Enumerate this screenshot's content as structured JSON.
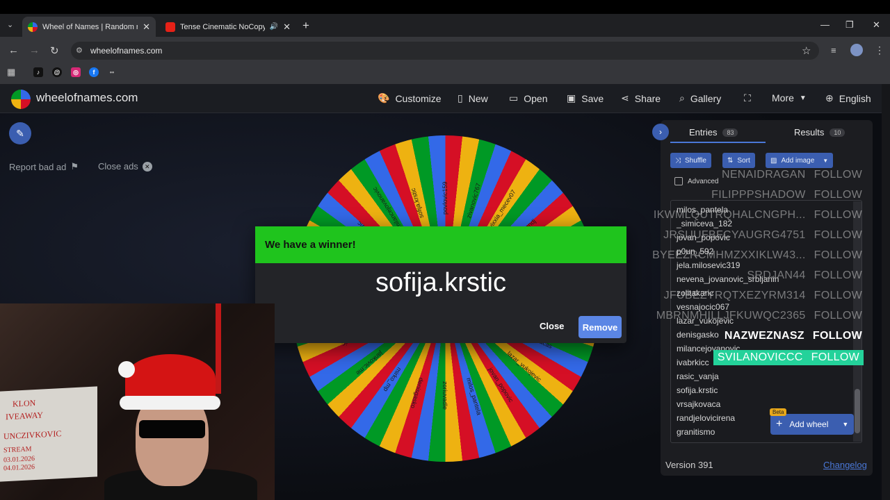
{
  "browser": {
    "tabs": [
      {
        "title": "Wheel of Names | Random nam",
        "active": true
      },
      {
        "title": "Tense Cinematic NoCopyrig",
        "active": false
      }
    ],
    "url": "wheelofnames.com"
  },
  "site": {
    "logo": "wheelofnames.com",
    "menu": [
      "Customize",
      "New",
      "Open",
      "Save",
      "Share",
      "Gallery",
      "More",
      "English"
    ],
    "report_bad_ad": "Report bad ad",
    "close_ads": "Close ads"
  },
  "wheel_labels": [
    "povlovic159",
    "zivanovic767",
    "vixxia_mecev07",
    "andjela_andj",
    "mendlo.bogatinov",
    "markosmdkovic9",
    "mana_dragan",
    "vsajkovacas",
    "lazar_vukojevic",
    "jovan_popovic",
    "milos_pantela",
    "zoriuvadle",
    "denisgasko",
    "mirko_mp",
    "jankovic.me",
    "stevanovic",
    "dijana_pajic",
    "xayrl_frisan",
    "minia_zviczcr",
    "sasiwojovic",
    "milancejovanovic",
    "sofija.krstic"
  ],
  "dialog": {
    "title": "We have a winner!",
    "winner": "sofija.krstic",
    "close_label": "Close",
    "remove_label": "Remove"
  },
  "panel": {
    "entries_tab": "Entries",
    "entries_count": "83",
    "results_tab": "Results",
    "results_count": "10",
    "shuffle": "Shuffle",
    "sort": "Sort",
    "add_image": "Add image",
    "advanced": "Advanced",
    "entries": [
      "milos_pantela",
      "_simiceva_182",
      "jovan_popovic",
      "p0un_592",
      "jela.milosevic319",
      "nevena_jovanovic_srbljanin",
      "zolitakaric",
      "vesnajocic067",
      "lazar_vukojevic",
      "denisgasko",
      "milancejovanovic",
      "ivabrkicc",
      "rasic_vanja",
      "sofija.krstic",
      "vrsajkovaca",
      "randjelovicirena",
      "granitismo"
    ],
    "add_wheel": "Add wheel",
    "beta": "Beta",
    "version": "Version 391",
    "changelog": "Changelog"
  },
  "overlay": {
    "follow_label": "FOLLOW",
    "names": [
      "NENAIDRAGAN",
      "FILIPPPSHADOW",
      "IKWMLQUTRQHALCNGPH...",
      "JRSUUFBFCYAUGRG4751",
      "BYEEZRCMHMZXXIKLW43...",
      "SRDJAN44",
      "JFUBEZYRQTXEZYRM314",
      "MBRNMHILLJFKUWQC2365",
      "NAZWEZNASZ",
      "SVILANOVICCC"
    ]
  },
  "colors": {
    "winner_header": "#1fc41d",
    "accent_blue": "#3b5eb0",
    "overlay_highlight": "#24d29a",
    "wheel": [
      "#d50f25",
      "#eeb211",
      "#009925",
      "#3369e8"
    ]
  }
}
